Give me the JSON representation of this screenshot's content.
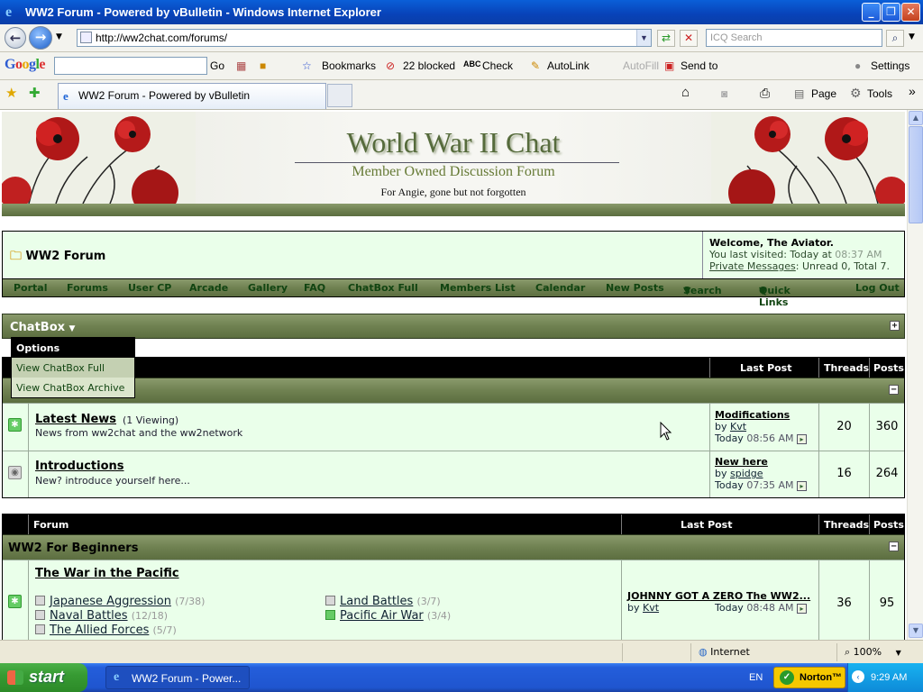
{
  "window": {
    "title": "WW2 Forum - Powered by vBulletin - Windows Internet Explorer"
  },
  "address": {
    "url": "http://ww2chat.com/forums/",
    "search_placeholder": "ICQ Search"
  },
  "google_toolbar": {
    "go": "Go",
    "bookmarks": "Bookmarks",
    "blocked": "22 blocked",
    "check": "Check",
    "autolink": "AutoLink",
    "autofill": "AutoFill",
    "sendto": "Send to",
    "settings": "Settings"
  },
  "favbar": {
    "tab_title": "WW2 Forum - Powered by vBulletin",
    "page": "Page",
    "tools": "Tools"
  },
  "banner": {
    "title": "World War II Chat",
    "subtitle": "Member Owned Discussion Forum",
    "dedication": "For Angie, gone but not forgotten"
  },
  "forum_header": {
    "title": "WW2 Forum",
    "welcome": "Welcome, The Aviator.",
    "last_visited_prefix": "You last visited: Today at",
    "last_visited_time": "08:37 AM",
    "pm_link": "Private Messages",
    "pm_info": ": Unread 0, Total 7."
  },
  "nav": [
    "Portal",
    "Forums",
    "User CP",
    "Arcade",
    "Gallery",
    "FAQ",
    "ChatBox Full",
    "Members List",
    "Calendar",
    "New Posts",
    "Search",
    "Quick Links",
    "Log Out"
  ],
  "chatbox": {
    "label": "ChatBox",
    "menu_header": "Options",
    "options": [
      "View ChatBox Full",
      "View ChatBox Archive"
    ]
  },
  "table1": {
    "headers": {
      "last_post": "Last Post",
      "threads": "Threads",
      "posts": "Posts"
    },
    "forums": [
      {
        "name": "Latest News",
        "viewing": "(1 Viewing)",
        "desc": "News from ww2chat and the ww2network",
        "lp_title": "Modifications",
        "lp_by": "by",
        "lp_user": "Kvt",
        "lp_day": "Today",
        "lp_time": "08:56 AM",
        "threads": "20",
        "posts": "360"
      },
      {
        "name": "Introductions",
        "viewing": "",
        "desc": "New? introduce yourself here...",
        "lp_title": "New here",
        "lp_by": "by",
        "lp_user": "spidge",
        "lp_day": "Today",
        "lp_time": "07:35 AM",
        "threads": "16",
        "posts": "264"
      }
    ]
  },
  "table2": {
    "headers": {
      "forum": "Forum",
      "last_post": "Last Post",
      "threads": "Threads",
      "posts": "Posts"
    },
    "category": "WW2 For Beginners",
    "forum": {
      "name": "The War in the Pacific",
      "lp_title": "JOHNNY GOT A ZERO The WW2...",
      "lp_by": "by",
      "lp_user": "Kvt",
      "lp_day": "Today",
      "lp_time": "08:48 AM",
      "threads": "36",
      "posts": "95"
    },
    "subforums": [
      {
        "name": "Japanese Aggression",
        "count": "(7/38)"
      },
      {
        "name": "Naval Battles",
        "count": "(12/18)"
      },
      {
        "name": "The Allied Forces",
        "count": "(5/7)"
      },
      {
        "name": "Land Battles",
        "count": "(3/7)"
      },
      {
        "name": "Pacific Air War",
        "count": "(3/4)"
      }
    ]
  },
  "statusbar": {
    "zone": "Internet",
    "zoom": "100%"
  },
  "taskbar": {
    "start": "start",
    "item": "WW2 Forum - Power...",
    "lang": "EN",
    "norton": "Norton™",
    "clock": "9:29 AM"
  }
}
